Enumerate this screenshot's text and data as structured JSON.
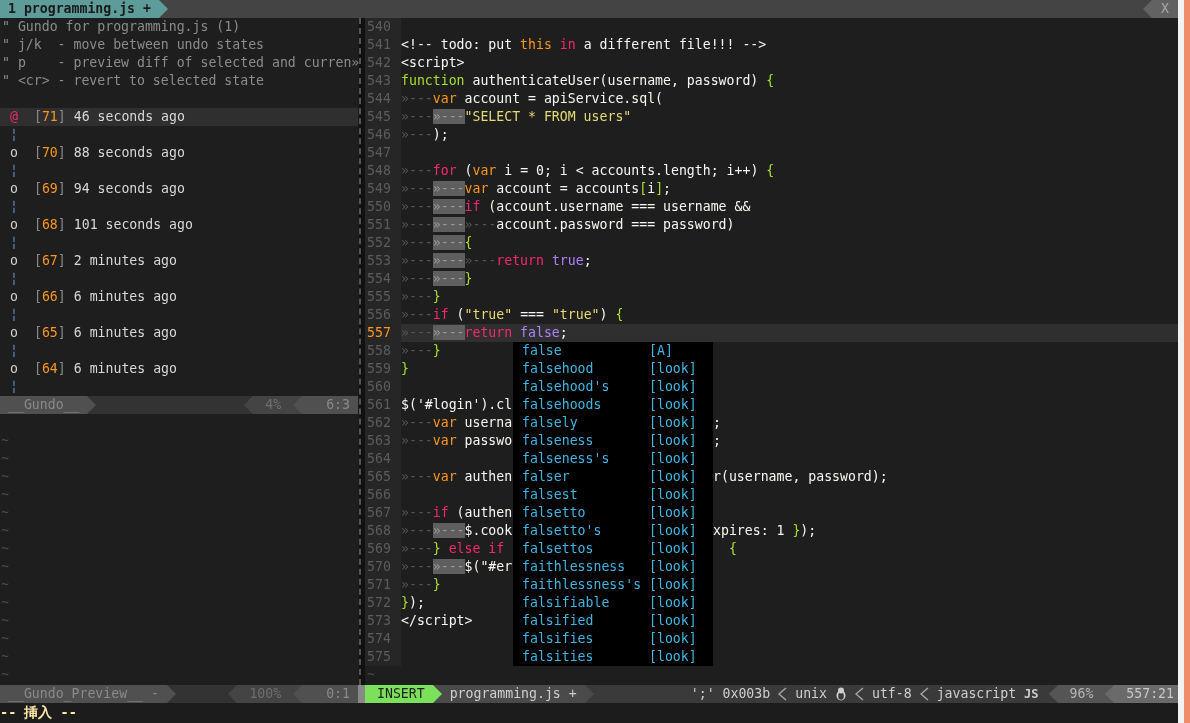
{
  "tabline": {
    "tabs": [
      {
        "label": "1 programming.js +",
        "selected": true
      }
    ],
    "close": "X"
  },
  "gundo": {
    "header": [
      "\" Gundo for programming.js (1)",
      "\" j/k  - move between undo states",
      "\" p    - preview diff of selected and curren»",
      "\" <cr> - revert to selected state"
    ],
    "entries": [
      {
        "marker": "@",
        "open": "[",
        "number": "71",
        "close": "]",
        "time": "46 seconds ago",
        "selected": true,
        "connector": "¦"
      },
      {
        "marker": "o",
        "open": "[",
        "number": "70",
        "close": "]",
        "time": "88 seconds ago",
        "selected": false,
        "connector": "¦"
      },
      {
        "marker": "o",
        "open": "[",
        "number": "69",
        "close": "]",
        "time": "94 seconds ago",
        "selected": false,
        "connector": "¦"
      },
      {
        "marker": "o",
        "open": "[",
        "number": "68",
        "close": "]",
        "time": "101 seconds ago",
        "selected": false,
        "connector": "¦"
      },
      {
        "marker": "o",
        "open": "[",
        "number": "67",
        "close": "]",
        "time": "2 minutes ago",
        "selected": false,
        "connector": "¦"
      },
      {
        "marker": "o",
        "open": "[",
        "number": "66",
        "close": "]",
        "time": "6 minutes ago",
        "selected": false,
        "connector": "¦"
      },
      {
        "marker": "o",
        "open": "[",
        "number": "65",
        "close": "]",
        "time": "6 minutes ago",
        "selected": false,
        "connector": "¦"
      },
      {
        "marker": "o",
        "open": "[",
        "number": "64",
        "close": "]",
        "time": "6 minutes ago",
        "selected": false,
        "connector": "¦"
      }
    ],
    "status": {
      "name": "__Gundo__",
      "percent": "4%",
      "position": "6:3"
    }
  },
  "preview": {
    "filler": [
      "~",
      "~",
      "~",
      "~",
      "~",
      "~",
      "~",
      "~",
      "~",
      "~",
      "~",
      "~",
      "~",
      "~"
    ],
    "status": {
      "name": "__Gundo_Preview__ -",
      "percent": "100%",
      "position": "0:1"
    }
  },
  "editor": {
    "lines": [
      {
        "number": "540",
        "current": false
      },
      {
        "number": "541",
        "current": false,
        "segments": [
          {
            "kind": "plain",
            "text": "<!-- todo: put "
          },
          {
            "kind": "type",
            "text": "this"
          },
          {
            "kind": "keyword",
            "text": " in"
          },
          {
            "kind": "plain",
            "text": " a different file!!! -->"
          }
        ]
      },
      {
        "number": "542",
        "current": false,
        "segments": [
          {
            "kind": "plain",
            "text": "<script>"
          }
        ]
      },
      {
        "number": "543",
        "current": false,
        "segments": [
          {
            "kind": "function",
            "text": "function"
          },
          {
            "kind": "plain",
            "text": " authenticateUser(username, password) "
          },
          {
            "kind": "function",
            "text": "{"
          }
        ]
      },
      {
        "number": "544",
        "current": false,
        "segments": [
          {
            "kind": "indent",
            "text": "»---"
          },
          {
            "kind": "type",
            "text": "var"
          },
          {
            "kind": "plain",
            "text": " account = apiService.sql("
          }
        ]
      },
      {
        "number": "545",
        "current": false,
        "segments": [
          {
            "kind": "indent",
            "text": "»---"
          },
          {
            "kind": "guide",
            "text": "»---"
          },
          {
            "kind": "string",
            "text": "\"SELECT * FROM users\""
          }
        ]
      },
      {
        "number": "546",
        "current": false,
        "segments": [
          {
            "kind": "indent",
            "text": "»---"
          },
          {
            "kind": "plain",
            "text": ");"
          }
        ]
      },
      {
        "number": "547",
        "current": false
      },
      {
        "number": "548",
        "current": false,
        "segments": [
          {
            "kind": "indent",
            "text": "»---"
          },
          {
            "kind": "keyword",
            "text": "for"
          },
          {
            "kind": "plain",
            "text": " ("
          },
          {
            "kind": "type",
            "text": "var"
          },
          {
            "kind": "plain",
            "text": " i = 0; i < accounts.length; i++) "
          },
          {
            "kind": "function",
            "text": "{"
          }
        ]
      },
      {
        "number": "549",
        "current": false,
        "segments": [
          {
            "kind": "indent",
            "text": "»---"
          },
          {
            "kind": "guide",
            "text": "»---"
          },
          {
            "kind": "type",
            "text": "var"
          },
          {
            "kind": "plain",
            "text": " account = accounts"
          },
          {
            "kind": "function",
            "text": "["
          },
          {
            "kind": "plain",
            "text": "i"
          },
          {
            "kind": "function",
            "text": "]"
          },
          {
            "kind": "plain",
            "text": ";"
          }
        ]
      },
      {
        "number": "550",
        "current": false,
        "segments": [
          {
            "kind": "indent",
            "text": "»---"
          },
          {
            "kind": "guide",
            "text": "»---"
          },
          {
            "kind": "keyword",
            "text": "if"
          },
          {
            "kind": "plain",
            "text": " (account.username === username &&"
          }
        ]
      },
      {
        "number": "551",
        "current": false,
        "segments": [
          {
            "kind": "indent",
            "text": "»---"
          },
          {
            "kind": "guide",
            "text": "»---"
          },
          {
            "kind": "indent",
            "text": "»---"
          },
          {
            "kind": "plain",
            "text": "account.password === password)"
          }
        ]
      },
      {
        "number": "552",
        "current": false,
        "segments": [
          {
            "kind": "indent",
            "text": "»---"
          },
          {
            "kind": "guide",
            "text": "»---"
          },
          {
            "kind": "function",
            "text": "{"
          }
        ]
      },
      {
        "number": "553",
        "current": false,
        "segments": [
          {
            "kind": "indent",
            "text": "»---"
          },
          {
            "kind": "guide",
            "text": "»---"
          },
          {
            "kind": "indent",
            "text": "»---"
          },
          {
            "kind": "keyword",
            "text": "return"
          },
          {
            "kind": "constant",
            "text": " true"
          },
          {
            "kind": "plain",
            "text": ";"
          }
        ]
      },
      {
        "number": "554",
        "current": false,
        "segments": [
          {
            "kind": "indent",
            "text": "»---"
          },
          {
            "kind": "guide",
            "text": "»---"
          },
          {
            "kind": "function",
            "text": "}"
          }
        ]
      },
      {
        "number": "555",
        "current": false,
        "segments": [
          {
            "kind": "indent",
            "text": "»---"
          },
          {
            "kind": "function",
            "text": "}"
          }
        ]
      },
      {
        "number": "556",
        "current": false,
        "segments": [
          {
            "kind": "indent",
            "text": "»---"
          },
          {
            "kind": "keyword",
            "text": "if"
          },
          {
            "kind": "plain",
            "text": " ("
          },
          {
            "kind": "string",
            "text": "\"true\""
          },
          {
            "kind": "plain",
            "text": " === "
          },
          {
            "kind": "string",
            "text": "\"true\""
          },
          {
            "kind": "plain",
            "text": ") "
          },
          {
            "kind": "function",
            "text": "{"
          }
        ]
      },
      {
        "number": "557",
        "current": true,
        "segments": [
          {
            "kind": "indent",
            "text": "»---"
          },
          {
            "kind": "guide",
            "text": "»---"
          },
          {
            "kind": "keyword",
            "text": "return"
          },
          {
            "kind": "constant",
            "text": " false"
          },
          {
            "kind": "plain",
            "text": ";"
          }
        ]
      },
      {
        "number": "558",
        "current": false,
        "segments": [
          {
            "kind": "indent",
            "text": "»---"
          },
          {
            "kind": "function",
            "text": "}"
          }
        ]
      },
      {
        "number": "559",
        "current": false,
        "segments": [
          {
            "kind": "function",
            "text": "}"
          }
        ]
      },
      {
        "number": "560",
        "current": false
      },
      {
        "number": "561",
        "current": false,
        "segments": [
          {
            "kind": "plain",
            "text": "$('#login').cl"
          }
        ]
      },
      {
        "number": "562",
        "current": false,
        "segments": [
          {
            "kind": "indent",
            "text": "»---"
          },
          {
            "kind": "type",
            "text": "var"
          },
          {
            "kind": "plain",
            "text": " userna"
          }
        ],
        "after_menu": [
          {
            "kind": "plain",
            "text": ";"
          }
        ]
      },
      {
        "number": "563",
        "current": false,
        "segments": [
          {
            "kind": "indent",
            "text": "»---"
          },
          {
            "kind": "type",
            "text": "var"
          },
          {
            "kind": "plain",
            "text": " passwo"
          }
        ],
        "after_menu": [
          {
            "kind": "plain",
            "text": ";"
          }
        ]
      },
      {
        "number": "564",
        "current": false
      },
      {
        "number": "565",
        "current": false,
        "segments": [
          {
            "kind": "indent",
            "text": "»---"
          },
          {
            "kind": "type",
            "text": "var"
          },
          {
            "kind": "plain",
            "text": " authen"
          }
        ],
        "after_menu": [
          {
            "kind": "plain",
            "text": "r(username, password);"
          }
        ]
      },
      {
        "number": "566",
        "current": false
      },
      {
        "number": "567",
        "current": false,
        "segments": [
          {
            "kind": "indent",
            "text": "»---"
          },
          {
            "kind": "keyword",
            "text": "if"
          },
          {
            "kind": "plain",
            "text": " (authen"
          }
        ]
      },
      {
        "number": "568",
        "current": false,
        "segments": [
          {
            "kind": "indent",
            "text": "»---"
          },
          {
            "kind": "guide",
            "text": "»---"
          },
          {
            "kind": "plain",
            "text": "$.cook"
          }
        ],
        "after_menu": [
          {
            "kind": "plain",
            "text": "xpires: 1 "
          },
          {
            "kind": "function",
            "text": "}"
          },
          {
            "kind": "plain",
            "text": ");"
          }
        ]
      },
      {
        "number": "569",
        "current": false,
        "segments": [
          {
            "kind": "indent",
            "text": "»---"
          },
          {
            "kind": "function",
            "text": "}"
          },
          {
            "kind": "keyword",
            "text": " else if"
          }
        ],
        "after_menu": [
          {
            "kind": "function",
            "text": "  {"
          }
        ]
      },
      {
        "number": "570",
        "current": false,
        "segments": [
          {
            "kind": "indent",
            "text": "»---"
          },
          {
            "kind": "guide",
            "text": "»---"
          },
          {
            "kind": "plain",
            "text": "$(\"#er"
          }
        ]
      },
      {
        "number": "571",
        "current": false,
        "segments": [
          {
            "kind": "indent",
            "text": "»---"
          },
          {
            "kind": "function",
            "text": "}"
          }
        ]
      },
      {
        "number": "572",
        "current": false,
        "segments": [
          {
            "kind": "function",
            "text": "}"
          },
          {
            "kind": "plain",
            "text": ");"
          }
        ]
      },
      {
        "number": "573",
        "current": false,
        "segments": [
          {
            "kind": "plain",
            "text": "</script>"
          }
        ]
      },
      {
        "number": "574",
        "current": false
      },
      {
        "number": "575",
        "current": false
      }
    ],
    "filler": [
      "~"
    ],
    "completion": {
      "items": [
        {
          "word": "false",
          "source": "[A]"
        },
        {
          "word": "falsehood",
          "source": "[look]"
        },
        {
          "word": "falsehood's",
          "source": "[look]"
        },
        {
          "word": "falsehoods",
          "source": "[look]"
        },
        {
          "word": "falsely",
          "source": "[look]"
        },
        {
          "word": "falseness",
          "source": "[look]"
        },
        {
          "word": "falseness's",
          "source": "[look]"
        },
        {
          "word": "falser",
          "source": "[look]"
        },
        {
          "word": "falsest",
          "source": "[look]"
        },
        {
          "word": "falsetto",
          "source": "[look]"
        },
        {
          "word": "falsetto's",
          "source": "[look]"
        },
        {
          "word": "falsettos",
          "source": "[look]"
        },
        {
          "word": "faithlessness",
          "source": "[look]"
        },
        {
          "word": "faithlessness's",
          "source": "[look]"
        },
        {
          "word": "falsifiable",
          "source": "[look]"
        },
        {
          "word": "falsified",
          "source": "[look]"
        },
        {
          "word": "falsifies",
          "source": "[look]"
        },
        {
          "word": "falsities",
          "source": "[look]"
        }
      ]
    },
    "status": {
      "mode": "INSERT",
      "file": "programming.js +",
      "char": "';' 0x003b",
      "format": "unix",
      "encoding": "utf-8",
      "filetype": "javascript",
      "filetype_badge": "JS",
      "percent": "96%",
      "position": "557:21"
    }
  },
  "command_line": "-- 挿入 --"
}
